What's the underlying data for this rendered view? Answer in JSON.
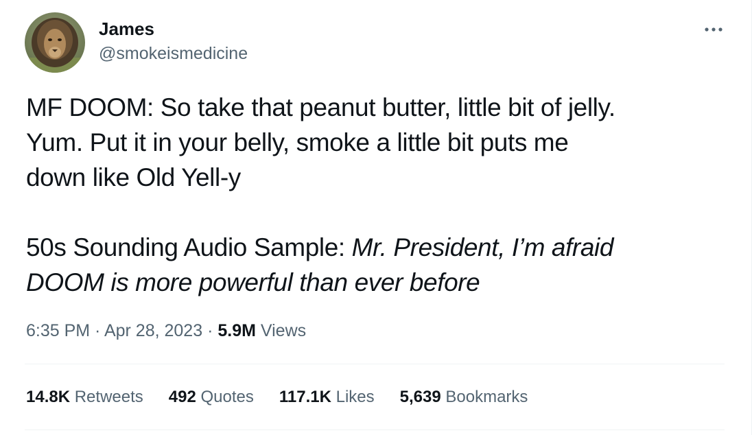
{
  "author": {
    "display_name": "James",
    "handle": "@smokeismedicine",
    "avatar_icon": "lion-avatar"
  },
  "more_icon": "more-horizontal-icon",
  "tweet": {
    "line1": "MF DOOM: So take that peanut butter, little bit of jelly.",
    "line2": "Yum. Put it in your belly, smoke a little bit puts me",
    "line3": "down like Old Yell-y",
    "line4_prefix": "50s Sounding Audio Sample: ",
    "line4_italic": "Mr. President, I’m afraid",
    "line5_italic": "DOOM is more powerful than ever before"
  },
  "meta": {
    "time": "6:35 PM",
    "separator": " · ",
    "date": "Apr 28, 2023",
    "views_count": "5.9M",
    "views_label": " Views"
  },
  "stats": [
    {
      "count": "14.8K",
      "label": " Retweets"
    },
    {
      "count": "492",
      "label": " Quotes"
    },
    {
      "count": "117.1K",
      "label": " Likes"
    },
    {
      "count": "5,639",
      "label": " Bookmarks"
    }
  ],
  "colors": {
    "text_primary": "#0f1419",
    "text_secondary": "#536471",
    "divider": "#eff3f4"
  }
}
